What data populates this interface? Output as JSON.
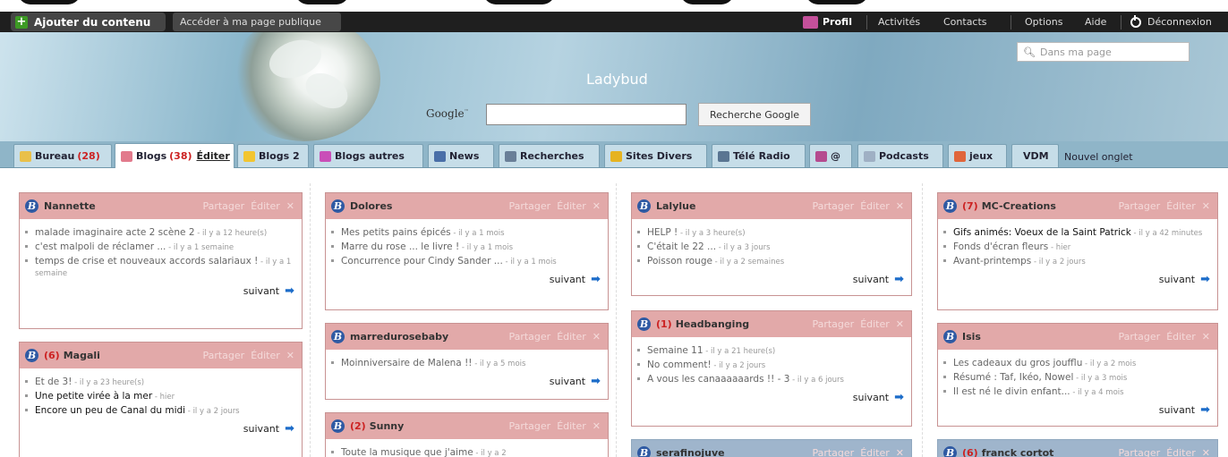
{
  "topbar": {
    "add_label": "Ajouter du contenu",
    "public_label": "Accéder à ma page publique",
    "profil": "Profil",
    "activites": "Activités",
    "contacts": "Contacts",
    "options": "Options",
    "aide": "Aide",
    "logout": "Déconnexion"
  },
  "banner": {
    "title": "Ladybud",
    "search_placeholder": "Dans ma page",
    "google_logo": "Google",
    "google_button": "Recherche Google"
  },
  "tabs": [
    {
      "label": "Bureau",
      "count": "(28)",
      "icon": "penguin-icon",
      "color": "#e9c04a"
    },
    {
      "label": "Blogs",
      "count": "(38)",
      "edit": "Éditer",
      "icon": "heart-icon",
      "color": "#e27a8c"
    },
    {
      "label": "Blogs 2",
      "icon": "smiley-icon",
      "color": "#f2c531"
    },
    {
      "label": "Blogs autres",
      "icon": "sticky-icon",
      "color": "#c94fb8"
    },
    {
      "label": "News",
      "icon": "book-icon",
      "color": "#4a6fa8"
    },
    {
      "label": "Recherches",
      "icon": "eye-icon",
      "color": "#6a7f98"
    },
    {
      "label": "Sites Divers",
      "icon": "star-icon",
      "color": "#e6b321"
    },
    {
      "label": "Télé Radio",
      "icon": "tv-icon",
      "color": "#5a7592"
    },
    {
      "label": "@",
      "icon": "mail-icon",
      "color": "#b54b8f"
    },
    {
      "label": "Podcasts",
      "icon": "podcast-icon",
      "color": "#9fb0c4"
    },
    {
      "label": "jeux",
      "icon": "rainbow-icon",
      "color": "#e0663c"
    },
    {
      "label": "VDM",
      "icon": "",
      "color": ""
    }
  ],
  "new_tab": "Nouvel onglet",
  "widget_actions": {
    "share": "Partager",
    "edit": "Éditer",
    "close": "✕"
  },
  "next_label": "suivant",
  "widgets": {
    "nannette": {
      "title": "Nannette",
      "items": [
        {
          "text": "malade imaginaire acte 2 scène 2",
          "when": " - il y a 12 heure(s)"
        },
        {
          "text": "c'est malpoli de réclamer ...",
          "when": " - il y a 1 semaine"
        },
        {
          "text": "temps de crise et nouveaux accords salariaux !",
          "when": " - il y a 1 semaine"
        }
      ]
    },
    "magali": {
      "count": "(6)",
      "title": "Magali",
      "items": [
        {
          "text": "Et de 3!",
          "when": " - il y a 23 heure(s)"
        },
        {
          "text": "Une petite virée à la mer",
          "when": " - hier"
        },
        {
          "text": "Encore un peu de Canal du midi",
          "when": " - il y a 2 jours"
        }
      ]
    },
    "dolores": {
      "title": "Dolores",
      "items": [
        {
          "text": "Mes petits pains épicés",
          "when": " - il y a 1 mois"
        },
        {
          "text": "Marre du rose ... le livre !",
          "when": " - il y a 1 mois"
        },
        {
          "text": "Concurrence pour Cindy Sander ...",
          "when": " - il y a 1 mois"
        }
      ]
    },
    "marredurosebaby": {
      "title": "marredurosebaby",
      "items": [
        {
          "text": "Moinniversaire de Malena !!",
          "when": " - il y a 5 mois"
        }
      ]
    },
    "sunny": {
      "count": "(2)",
      "title": "Sunny",
      "items": [
        {
          "text": "Toute la musique que j'aime",
          "when": " - il y a 2"
        }
      ]
    },
    "lalylue": {
      "title": "Lalylue",
      "items": [
        {
          "text": "HELP !",
          "when": " - il y a 3 heure(s)"
        },
        {
          "text": "C'était le 22 ...",
          "when": " - il y a 3 jours"
        },
        {
          "text": "Poisson rouge",
          "when": " - il y a 2 semaines"
        }
      ]
    },
    "headbanging": {
      "count": "(1)",
      "title": "Headbanging",
      "items": [
        {
          "text": "Semaine 11",
          "when": " - il y a 21 heure(s)"
        },
        {
          "text": "No comment!",
          "when": " - il y a 2 jours"
        },
        {
          "text": "A vous les canaaaaaards !! - 3",
          "when": " - il y a 6 jours"
        }
      ]
    },
    "serafinojuve": {
      "title": "serafinojuve"
    },
    "mccreations": {
      "count": "(7)",
      "title": "MC-Creations",
      "items": [
        {
          "text": "Gifs animés: Voeux de la Saint Patrick",
          "when": " - il y a 42 minutes"
        },
        {
          "text": "Fonds d'écran fleurs",
          "when": " - hier"
        },
        {
          "text": "Avant-printemps",
          "when": " - il y a 2 jours"
        }
      ]
    },
    "isis": {
      "title": "Isis",
      "items": [
        {
          "text": "Les cadeaux du gros joufflu",
          "when": " - il y a 2 mois"
        },
        {
          "text": "Résumé : Taf, Ikéo, Nowel",
          "when": " - il y a 3 mois"
        },
        {
          "text": "Il est né le divin enfant...",
          "when": " - il y a 4 mois"
        }
      ]
    },
    "franck": {
      "count": "(6)",
      "title": "franck cortot"
    }
  }
}
